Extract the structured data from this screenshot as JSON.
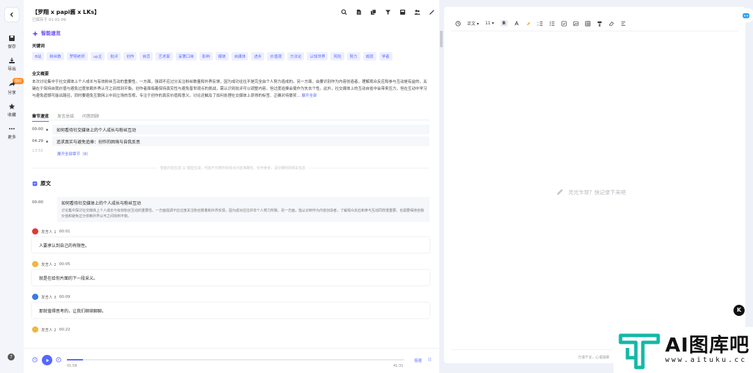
{
  "header": {
    "title": "【罗翔 x papi酱 x LKs】",
    "subtitle": "已保存于 01:01:09"
  },
  "rail": {
    "items": [
      {
        "label": "保存",
        "icon": "save-icon"
      },
      {
        "label": "导出",
        "icon": "export-icon"
      },
      {
        "label": "分享",
        "icon": "share-icon"
      },
      {
        "label": "收藏",
        "icon": "star-icon"
      },
      {
        "label": "更多",
        "icon": "more-icon"
      }
    ],
    "hot_badge": "限时"
  },
  "ai": {
    "heading": "智能速览",
    "keywords_label": "关键词",
    "keywords": [
      "B站",
      "粉丝数",
      "罗翔老师",
      "up主",
      "批评",
      "创作",
      "自恋",
      "艺术家",
      "采第口味",
      "影响",
      "媒体",
      "自媒体",
      "进步",
      "价值观",
      "方法论",
      "认知世界",
      "风险",
      "努力",
      "成就",
      "学者"
    ],
    "summary_label": "全文概要",
    "summary_text": "本次讨论集中于社交媒体上个人成长与有效粉丝互动的重要性。一方面，强调不应过分关注粉丝数量和外界反馈，因为成功往往不是完全由个人努力造成的。另一方面，由要识别作为内容创造者，理解观众反应和参与互动是有益的，关键在于保持自我价值与避免过度依赖外界认可之间找到平衡。创作者面临着保持真实性与避免普世观点的挑战，需认识到批评可以调整内容，但过度追捧会使作为失去个性。此外，社交媒体上的互动自省中会带来压力，但在互动中学习与避免遗憾可能出路径，同时要避免互联网上中间立场的忽视，专注于创作的真实价值和意义。讨论还触及了如何处理社交媒体上获得的标签、正确对待褒奖...",
    "summary_more": "展开全部"
  },
  "tabs": [
    {
      "label": "章节速览",
      "active": true
    },
    {
      "label": "发言总结",
      "active": false
    },
    {
      "label": "问答回顾",
      "active": false
    }
  ],
  "chapters": [
    {
      "time": "00:00",
      "title": "如何看待社交媒体上的个人成长与粉丝互动"
    },
    {
      "time": "04:29",
      "title": "追求真实与避免追捧：创作的困境与自我反思"
    }
  ],
  "chapter_faded_time": "13:55",
  "chapter_more": "展开全部章节（8）",
  "divider_note": "智能内容生成 以 模型生成，可能不代表所有观点内容准确性，仅作参考，请仔细判别相关信息",
  "original": {
    "heading": "原文",
    "block": {
      "time": "00:00",
      "title": "如何看待社交媒体上的个人成长与粉丝互动",
      "text": "讨论集中探讨社交媒体上个人成长与有效粉丝互动的重要性。一方面强调不应过度关注粉丝数量和外界反馈，因为成功往往并非个人努力所致。另一方面，指认识到作为内容创造者，了解观众反应和参与互动同样很重要。也需要保持自我价值和避免过分依赖外界认可之间找到平衡。"
    },
    "speakers": [
      {
        "name": "发言人 1",
        "time": "00:01",
        "text": "人要承认到自己的有限性。",
        "color": "#e23a2f"
      },
      {
        "name": "发言人 2",
        "time": "00:05",
        "text": "就是在给你片面的下一段采义。",
        "color": "#f2b640"
      },
      {
        "name": "发言人 3",
        "time": "00:09",
        "text": "那就值得思考的，让我们继续聊聊。",
        "color": "#3a7be2"
      },
      {
        "name": "发言人 2",
        "time": "00:22",
        "text": "",
        "color": "#f2b640"
      }
    ]
  },
  "player": {
    "current": "01:58",
    "total": "41:31",
    "progress": 0.048,
    "speed_label": "倍速"
  },
  "editor": {
    "font_style": "正文",
    "font_size": "11",
    "bold": "B",
    "placeholder": "灵光乍现？快记录下来吧",
    "word_count": "万语千言，心语独章"
  },
  "side_badge": "K",
  "watermark": {
    "text": "AI图库吧",
    "url": "www.aituku.cc"
  },
  "colors": {
    "accent": "#5468ff",
    "ai_purple": "#6b4cf6",
    "hot": "#ff8a1f",
    "logo_teal": "#14b8a6"
  }
}
